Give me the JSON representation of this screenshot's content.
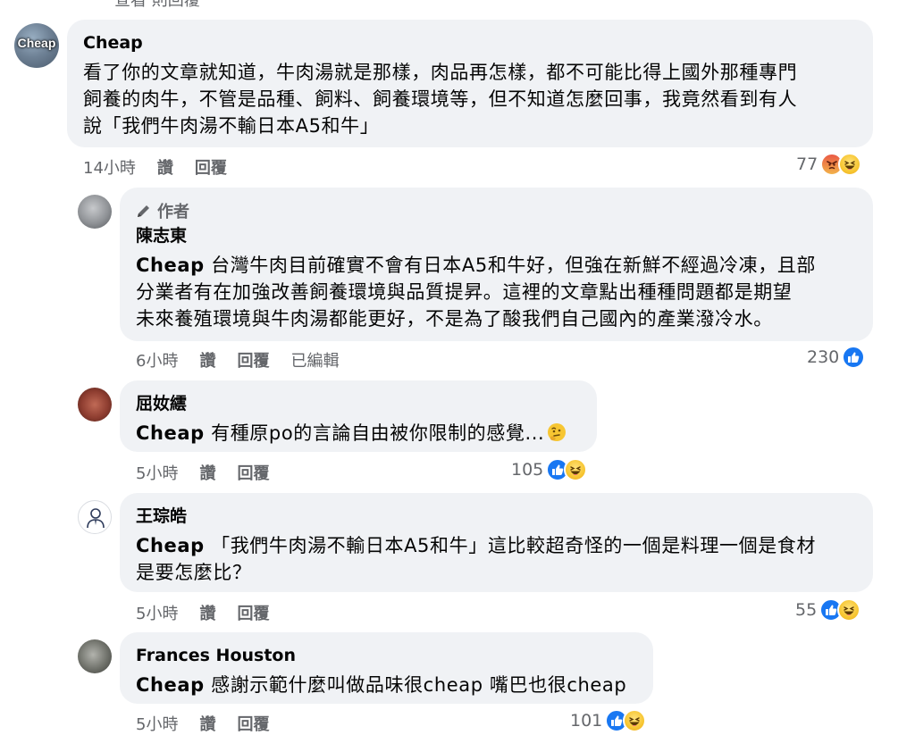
{
  "top_clip": "查看  則回覆",
  "comments": [
    {
      "name": "Cheap",
      "avatar_text": "Cheap",
      "lines": [
        "看了你的文章就知道，牛肉湯就是那樣，肉品再怎樣，都不可能比得上國外那種專門",
        "飼養的肉牛，不管是品種、飼料、飼養環境等，但不知道怎麼回事，我竟然看到有人",
        "說「我們牛肉湯不輸日本A5和牛」"
      ],
      "time": "14小時",
      "like_label": "讚",
      "reply_label": "回覆",
      "reaction_count": "77",
      "reactions": [
        "angry-icon",
        "haha-icon"
      ]
    },
    {
      "badge": "作者",
      "name": "陳志東",
      "mention": "Cheap",
      "lines": [
        " 台灣牛肉目前確實不會有日本A5和牛好，但強在新鮮不經過冷凍，且部",
        "分業者有在加強改善飼養環境與品質提昇。這裡的文章點出種種問題都是期望",
        "未來養殖環境與牛肉湯都能更好，不是為了酸我們自己國內的產業潑冷水。"
      ],
      "time": "6小時",
      "like_label": "讚",
      "reply_label": "回覆",
      "edited_label": "已編輯",
      "reaction_count": "230",
      "reactions": [
        "like-icon"
      ]
    },
    {
      "name": "屈奻繧",
      "mention": "Cheap",
      "lines": [
        " 有種原po的言論自由被你限制的感覺..."
      ],
      "inline_emoji": "thinking-emoji",
      "time": "5小時",
      "like_label": "讚",
      "reply_label": "回覆",
      "reaction_count": "105",
      "reactions": [
        "like-icon",
        "haha-icon"
      ]
    },
    {
      "name": "王琮皓",
      "mention": "Cheap",
      "lines": [
        " 「我們牛肉湯不輸日本A5和牛」這比較超奇怪的一個是料理一個是食材",
        "是要怎麼比？"
      ],
      "time": "5小時",
      "like_label": "讚",
      "reply_label": "回覆",
      "reaction_count": "55",
      "reactions": [
        "like-icon",
        "haha-icon"
      ]
    },
    {
      "name": "Frances Houston",
      "mention": "Cheap",
      "lines": [
        " 感謝示範什麼叫做品味很cheap 嘴巴也很cheap"
      ],
      "time": "5小時",
      "like_label": "讚",
      "reply_label": "回覆",
      "reaction_count": "101",
      "reactions": [
        "like-icon",
        "haha-icon"
      ]
    }
  ],
  "colors": {
    "bubble": "#f0f2f5",
    "meta_text": "#65676b",
    "like_blue": "#1877f2",
    "text": "#050505"
  }
}
